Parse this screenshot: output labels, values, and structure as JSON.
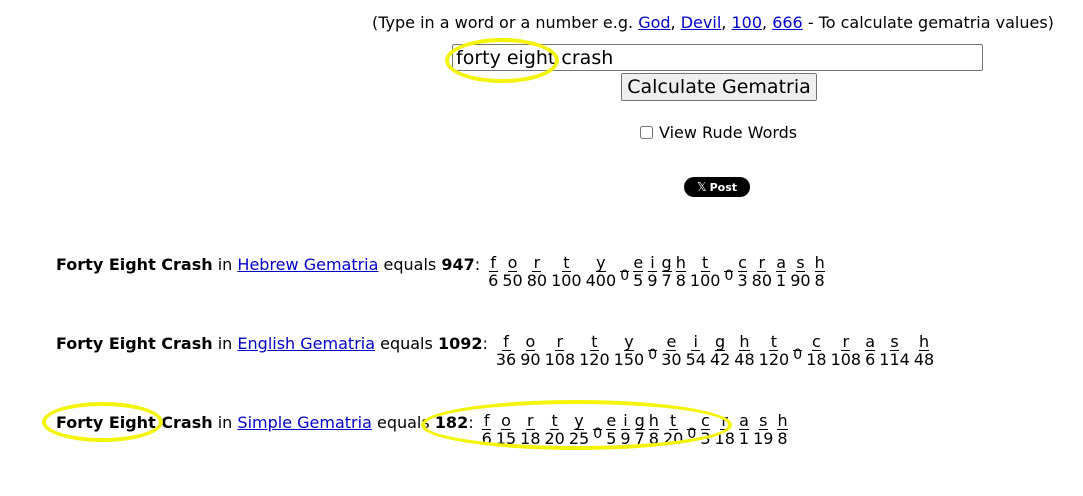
{
  "header": {
    "hint_prefix": "(Type in a word or a number e.g.",
    "examples": [
      "God",
      "Devil",
      "100",
      "666"
    ],
    "sep": ",",
    "hint_suffix": "- To calculate gematria values)"
  },
  "search": {
    "value": "forty eight crash"
  },
  "calculate_button": "Calculate Gematria",
  "rude_words": {
    "label": "View Rude Words",
    "checked": false
  },
  "share": {
    "label": "Post",
    "icon": "x-logo-icon"
  },
  "results": [
    {
      "phrase": "Forty Eight Crash",
      "in": "in",
      "cipher": "Hebrew Gematria",
      "equals": "equals",
      "total": "947",
      "letters": [
        {
          "l": "f",
          "v": "6"
        },
        {
          "l": "o",
          "v": "50"
        },
        {
          "l": "r",
          "v": "80"
        },
        {
          "l": "t",
          "v": "100"
        },
        {
          "l": "y",
          "v": "400"
        },
        {
          "l": "_",
          "v": "0"
        },
        {
          "l": "e",
          "v": "5"
        },
        {
          "l": "i",
          "v": "9"
        },
        {
          "l": "g",
          "v": "7"
        },
        {
          "l": "h",
          "v": "8"
        },
        {
          "l": "t",
          "v": "100"
        },
        {
          "l": "_",
          "v": "0"
        },
        {
          "l": "c",
          "v": "3"
        },
        {
          "l": "r",
          "v": "80"
        },
        {
          "l": "a",
          "v": "1"
        },
        {
          "l": "s",
          "v": "90"
        },
        {
          "l": "h",
          "v": "8"
        }
      ]
    },
    {
      "phrase": "Forty Eight Crash",
      "in": "in",
      "cipher": "English Gematria",
      "equals": "equals",
      "total": "1092",
      "letters": [
        {
          "l": "f",
          "v": "36"
        },
        {
          "l": "o",
          "v": "90"
        },
        {
          "l": "r",
          "v": "108"
        },
        {
          "l": "t",
          "v": "120"
        },
        {
          "l": "y",
          "v": "150"
        },
        {
          "l": "_",
          "v": "0"
        },
        {
          "l": "e",
          "v": "30"
        },
        {
          "l": "i",
          "v": "54"
        },
        {
          "l": "g",
          "v": "42"
        },
        {
          "l": "h",
          "v": "48"
        },
        {
          "l": "t",
          "v": "120"
        },
        {
          "l": "_",
          "v": "0"
        },
        {
          "l": "c",
          "v": "18"
        },
        {
          "l": "r",
          "v": "108"
        },
        {
          "l": "a",
          "v": "6"
        },
        {
          "l": "s",
          "v": "114"
        },
        {
          "l": "h",
          "v": "48"
        }
      ]
    },
    {
      "phrase": "Forty Eight Crash",
      "in": "in",
      "cipher": "Simple Gematria",
      "equals": "equals",
      "total": "182",
      "letters": [
        {
          "l": "f",
          "v": "6"
        },
        {
          "l": "o",
          "v": "15"
        },
        {
          "l": "r",
          "v": "18"
        },
        {
          "l": "t",
          "v": "20"
        },
        {
          "l": "y",
          "v": "25"
        },
        {
          "l": "_",
          "v": "0"
        },
        {
          "l": "e",
          "v": "5"
        },
        {
          "l": "i",
          "v": "9"
        },
        {
          "l": "g",
          "v": "7"
        },
        {
          "l": "h",
          "v": "8"
        },
        {
          "l": "t",
          "v": "20"
        },
        {
          "l": "_",
          "v": "0"
        },
        {
          "l": "c",
          "v": "3"
        },
        {
          "l": "r",
          "v": "18"
        },
        {
          "l": "a",
          "v": "1"
        },
        {
          "l": "s",
          "v": "19"
        },
        {
          "l": "h",
          "v": "8"
        }
      ]
    }
  ],
  "annotation_color": "#f4f40a"
}
